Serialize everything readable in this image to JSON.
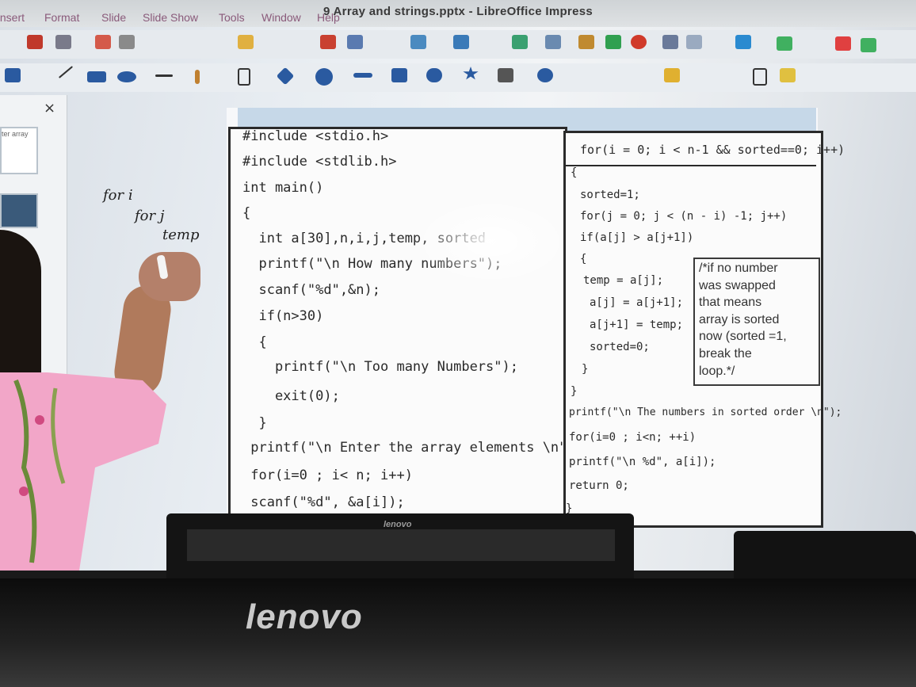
{
  "window": {
    "title": "9 Array and strings.pptx - LibreOffice Impress"
  },
  "menu": {
    "items": [
      "Insert",
      "Format",
      "Slide",
      "Slide Show",
      "Tools",
      "Window",
      "Help"
    ]
  },
  "side_panel": {
    "close_symbol": "×",
    "thumb_label": "ter array"
  },
  "slide": {
    "left_code": [
      "#include <stdio.h>",
      "#include <stdlib.h>",
      "int main()",
      "{",
      "  int a[30],n,i,j,temp, sorted",
      "  printf(\"\\n How many numbers\");",
      "  scanf(\"%d\",&n);",
      "  if(n>30)",
      "  {",
      "    printf(\"\\n Too many Numbers\");",
      "    exit(0);",
      "  }",
      " printf(\"\\n Enter the array elements \\n\");",
      " for(i=0 ; i< n; i++)",
      " scanf(\"%d\", &a[i]);"
    ],
    "right_header": "for(i = 0; i < n-1 && sorted==0; i++)",
    "right_code": [
      "{",
      "sorted=1;",
      "for(j = 0; j < (n - i) -1; j++)",
      "if(a[j] > a[j+1])",
      "{",
      "temp = a[j];",
      "a[j] = a[j+1];",
      "a[j+1] = temp;",
      "sorted=0;",
      "}",
      "}",
      "printf(\"\\n The numbers in sorted order \\n\");",
      "for(i=0 ; i<n; ++i)",
      "printf(\"\\n %d\", a[i]);",
      "return 0;",
      "}"
    ],
    "comment": [
      "/*if no number",
      "was swapped",
      "that means",
      "array is sorted",
      "now (sorted =1,",
      "break the",
      "loop.*/"
    ]
  },
  "handwriting": [
    "for i",
    "for j",
    "temp"
  ],
  "monitors": {
    "brand_small": "lenovo",
    "brand_big": "lenovo"
  },
  "colors": {
    "menu_text": "#8a5a7a",
    "slide_header_bar": "#c6d8e8",
    "code_text": "#2a2a2a",
    "shirt": "#f2a6c8"
  }
}
